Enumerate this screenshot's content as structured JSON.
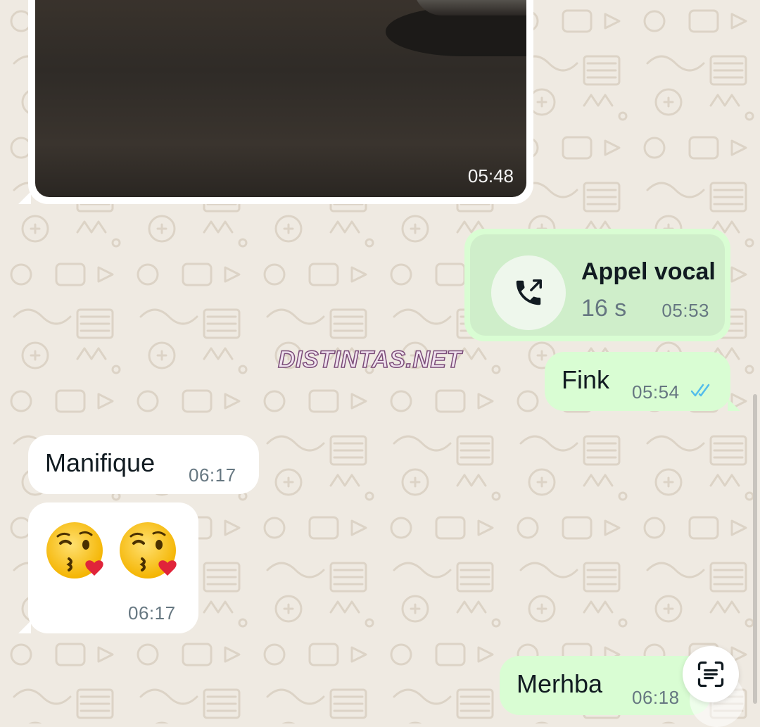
{
  "watermark": "DISTINTAS.NET",
  "messages": {
    "image": {
      "time": "05:48"
    },
    "call": {
      "title": "Appel vocal",
      "duration": "16 s",
      "time": "05:53",
      "icon": "outgoing-call-icon"
    },
    "fink": {
      "text": "Fink",
      "time": "05:54",
      "status_icon": "double-check-icon"
    },
    "manifique": {
      "text": "Manifique",
      "time": "06:17"
    },
    "emoji": {
      "time": "06:17",
      "emoji_icon": "kissing-heart-face"
    },
    "merhba": {
      "text": "Merhba",
      "time": "06:18"
    }
  },
  "floating_action": {
    "icon": "text-scan-icon"
  },
  "colors": {
    "chat_background": "#efeae2",
    "incoming_bubble": "#ffffff",
    "outgoing_bubble": "#d9fdd3",
    "read_ticks": "#53bdeb",
    "timestamp": "#667781"
  }
}
